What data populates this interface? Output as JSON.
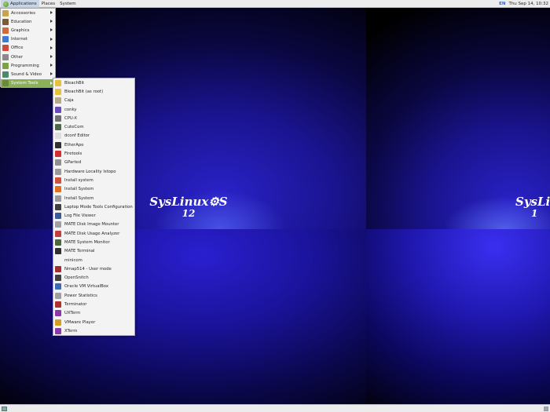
{
  "top_panel": {
    "menu": [
      "Applications",
      "Places",
      "System"
    ],
    "keyboard_layout": "EN",
    "clock": "Thu Sep 14, 10:32"
  },
  "wallpaper": {
    "logo_line1": "SysLinux",
    "logo_suffix": "S",
    "logo_line2": "12",
    "logo2_line1": "SysLi",
    "logo2_line2": "1"
  },
  "categories": [
    {
      "label": "Accessories",
      "icon": "accessories-icon",
      "color": "#c9a24a"
    },
    {
      "label": "Education",
      "icon": "education-icon",
      "color": "#7a5c3a"
    },
    {
      "label": "Graphics",
      "icon": "graphics-icon",
      "color": "#d06a3a"
    },
    {
      "label": "Internet",
      "icon": "internet-icon",
      "color": "#3b7bd4"
    },
    {
      "label": "Office",
      "icon": "office-icon",
      "color": "#d04a3a"
    },
    {
      "label": "Other",
      "icon": "other-icon",
      "color": "#8a8a8a"
    },
    {
      "label": "Programming",
      "icon": "programming-icon",
      "color": "#7fa04a"
    },
    {
      "label": "Sound & Video",
      "icon": "sound-video-icon",
      "color": "#4a8a6a"
    },
    {
      "label": "System Tools",
      "icon": "system-tools-icon",
      "color": "#6a8a3a"
    }
  ],
  "active_category": "System Tools",
  "system_tools": [
    {
      "label": "BleachBit",
      "icon": "bleachbit-icon",
      "color": "#e8c040"
    },
    {
      "label": "BleachBit (as root)",
      "icon": "bleachbit-root-icon",
      "color": "#e8c040"
    },
    {
      "label": "Caja",
      "icon": "caja-icon",
      "color": "#b8a888"
    },
    {
      "label": "conky",
      "icon": "conky-icon",
      "color": "#6a4ab8"
    },
    {
      "label": "CPU-X",
      "icon": "cpu-x-icon",
      "color": "#707070"
    },
    {
      "label": "CuteCom",
      "icon": "cutecom-icon",
      "color": "#4a6a4a"
    },
    {
      "label": "dconf Editor",
      "icon": "dconf-editor-icon",
      "color": "#dcdcdc"
    },
    {
      "label": "EtherApe",
      "icon": "etherape-icon",
      "color": "#303030"
    },
    {
      "label": "Firetools",
      "icon": "firetools-icon",
      "color": "#d03030"
    },
    {
      "label": "GParted",
      "icon": "gparted-icon",
      "color": "#909090"
    },
    {
      "label": "Hardware Locality lstopo",
      "icon": "lstopo-icon",
      "color": "#9a9a9a"
    },
    {
      "label": "Install system",
      "icon": "install-system-icon",
      "color": "#d05040"
    },
    {
      "label": "Install System",
      "icon": "install-system-alt-icon",
      "color": "#e07020"
    },
    {
      "label": "Install System",
      "icon": "install-system-alt2-icon",
      "color": "#9a9a9a"
    },
    {
      "label": "Laptop Mode Tools Configuration",
      "icon": "laptop-mode-icon",
      "color": "#404040"
    },
    {
      "label": "Log File Viewer",
      "icon": "log-viewer-icon",
      "color": "#3a5a9a"
    },
    {
      "label": "MATE Disk Image Mounter",
      "icon": "disk-image-mounter-icon",
      "color": "#a0a0a0"
    },
    {
      "label": "MATE Disk Usage Analyzer",
      "icon": "disk-usage-analyzer-icon",
      "color": "#c04040"
    },
    {
      "label": "MATE System Monitor",
      "icon": "system-monitor-icon",
      "color": "#4a6a3a"
    },
    {
      "label": "MATE Terminal",
      "icon": "mate-terminal-icon",
      "color": "#303030"
    },
    {
      "label": "minicom",
      "icon": "minicom-icon",
      "color": ""
    },
    {
      "label": "Nmap514 - User mode",
      "icon": "nmap-icon",
      "color": "#a03030"
    },
    {
      "label": "OpenSnitch",
      "icon": "opensnitch-icon",
      "color": "#404040"
    },
    {
      "label": "Oracle VM VirtualBox",
      "icon": "virtualbox-icon",
      "color": "#3a6ab8"
    },
    {
      "label": "Power Statistics",
      "icon": "power-statistics-icon",
      "color": "#a0a0a0"
    },
    {
      "label": "Terminator",
      "icon": "terminator-icon",
      "color": "#b03030"
    },
    {
      "label": "UXTerm",
      "icon": "uxterm-icon",
      "color": "#8a3aa8"
    },
    {
      "label": "VMware Player",
      "icon": "vmware-player-icon",
      "color": "#d0a020"
    },
    {
      "label": "XTerm",
      "icon": "xterm-icon",
      "color": "#8a3aa8"
    }
  ]
}
